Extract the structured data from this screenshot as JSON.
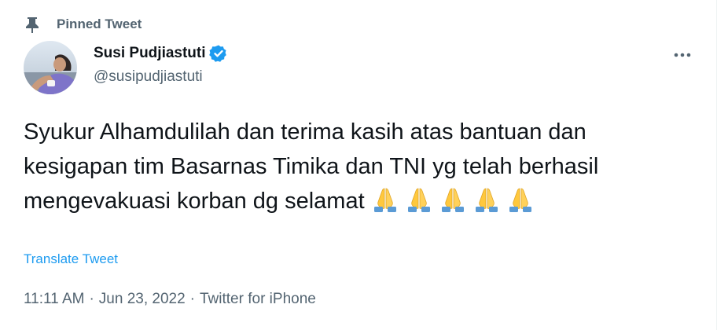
{
  "pinned": {
    "label": "Pinned Tweet",
    "icon": "pin-icon"
  },
  "author": {
    "display_name": "Susi Pudjiastuti",
    "handle": "@susipudjiastuti",
    "verified": true,
    "verified_color": "#1d9bf0",
    "avatar_icon": "avatar-photo"
  },
  "more_menu": {
    "icon": "more-horizontal-icon"
  },
  "tweet": {
    "text": "Syukur Alhamdulilah dan terima kasih atas bantuan dan kesigapan tim Basarnas Timika dan TNI yg telah berhasil mengevakuasi korban dg selamat",
    "emoji": "🙏",
    "emoji_count": 5,
    "emoji_icon": "folded-hands-emoji"
  },
  "translate": {
    "label": "Translate Tweet"
  },
  "meta": {
    "time": "11:11 AM",
    "separator": "·",
    "date": "Jun 23, 2022",
    "source": "Twitter for iPhone"
  },
  "colors": {
    "text_primary": "#0f1419",
    "text_secondary": "#536471",
    "link": "#1d9bf0"
  }
}
